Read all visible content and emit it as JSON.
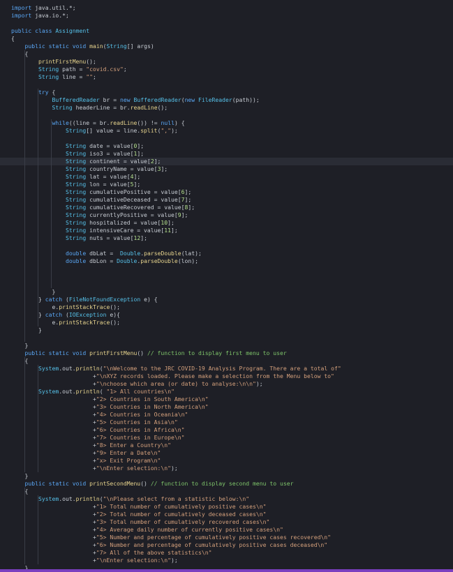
{
  "editor": {
    "lines": [
      [
        [
          "kw",
          "import"
        ],
        [
          "txt",
          " java.util.*;"
        ]
      ],
      [
        [
          "kw",
          "import"
        ],
        [
          "txt",
          " java.io.*;"
        ]
      ],
      [],
      [
        [
          "kw",
          "public class"
        ],
        [
          "ty",
          " Assignment"
        ]
      ],
      [
        [
          "txt",
          "{"
        ]
      ],
      [
        [
          "txt",
          "    "
        ],
        [
          "kw",
          "public static void"
        ],
        [
          "fn",
          " main"
        ],
        [
          "txt",
          "("
        ],
        [
          "ty",
          "String"
        ],
        [
          "txt",
          "[] args)"
        ]
      ],
      [
        [
          "txt",
          "    {"
        ]
      ],
      [
        [
          "txt",
          "        "
        ],
        [
          "fn",
          "printFirstMenu"
        ],
        [
          "txt",
          "();"
        ]
      ],
      [
        [
          "txt",
          "        "
        ],
        [
          "ty",
          "String"
        ],
        [
          "txt",
          " path = "
        ],
        [
          "str",
          "\"covid.csv\""
        ],
        [
          "txt",
          ";"
        ]
      ],
      [
        [
          "txt",
          "        "
        ],
        [
          "ty",
          "String"
        ],
        [
          "txt",
          " line = "
        ],
        [
          "str",
          "\"\""
        ],
        [
          "txt",
          ";"
        ]
      ],
      [],
      [
        [
          "txt",
          "        "
        ],
        [
          "kw",
          "try"
        ],
        [
          "txt",
          " {"
        ]
      ],
      [
        [
          "txt",
          "            "
        ],
        [
          "ty",
          "BufferedReader"
        ],
        [
          "txt",
          " br = "
        ],
        [
          "kw",
          "new"
        ],
        [
          "ty",
          " BufferedReader"
        ],
        [
          "txt",
          "("
        ],
        [
          "kw",
          "new"
        ],
        [
          "ty",
          " FileReader"
        ],
        [
          "txt",
          "(path));"
        ]
      ],
      [
        [
          "txt",
          "            "
        ],
        [
          "ty",
          "String"
        ],
        [
          "txt",
          " headerLine = br."
        ],
        [
          "fn",
          "readLine"
        ],
        [
          "txt",
          "();"
        ]
      ],
      [],
      [
        [
          "txt",
          "            "
        ],
        [
          "kw",
          "while"
        ],
        [
          "txt",
          "((line = br."
        ],
        [
          "fn",
          "readLine"
        ],
        [
          "txt",
          "()) != "
        ],
        [
          "kw",
          "null"
        ],
        [
          "txt",
          ") {"
        ]
      ],
      [
        [
          "txt",
          "                "
        ],
        [
          "ty",
          "String"
        ],
        [
          "txt",
          "[] value = line."
        ],
        [
          "fn",
          "split"
        ],
        [
          "txt",
          "("
        ],
        [
          "str",
          "\",\""
        ],
        [
          "txt",
          ");"
        ]
      ],
      [],
      [
        [
          "txt",
          "                "
        ],
        [
          "ty",
          "String"
        ],
        [
          "txt",
          " date = value["
        ],
        [
          "num",
          "0"
        ],
        [
          "txt",
          "];"
        ]
      ],
      [
        [
          "txt",
          "                "
        ],
        [
          "ty",
          "String"
        ],
        [
          "txt",
          " iso3 = value["
        ],
        [
          "num",
          "1"
        ],
        [
          "txt",
          "];"
        ]
      ],
      [
        [
          "txt",
          "                "
        ],
        [
          "ty",
          "String"
        ],
        [
          "txt",
          " continent = value["
        ],
        [
          "num",
          "2"
        ],
        [
          "txt",
          "];"
        ]
      ],
      [
        [
          "txt",
          "                "
        ],
        [
          "ty",
          "String"
        ],
        [
          "txt",
          " countryName = value["
        ],
        [
          "num",
          "3"
        ],
        [
          "txt",
          "];"
        ]
      ],
      [
        [
          "txt",
          "                "
        ],
        [
          "ty",
          "String"
        ],
        [
          "txt",
          " lat = value["
        ],
        [
          "num",
          "4"
        ],
        [
          "txt",
          "];"
        ]
      ],
      [
        [
          "txt",
          "                "
        ],
        [
          "ty",
          "String"
        ],
        [
          "txt",
          " lon = value["
        ],
        [
          "num",
          "5"
        ],
        [
          "txt",
          "];"
        ]
      ],
      [
        [
          "txt",
          "                "
        ],
        [
          "ty",
          "String"
        ],
        [
          "txt",
          " cumulativePositive = value["
        ],
        [
          "num",
          "6"
        ],
        [
          "txt",
          "];"
        ]
      ],
      [
        [
          "txt",
          "                "
        ],
        [
          "ty",
          "String"
        ],
        [
          "txt",
          " cumulativeDeceased = value["
        ],
        [
          "num",
          "7"
        ],
        [
          "txt",
          "];"
        ]
      ],
      [
        [
          "txt",
          "                "
        ],
        [
          "ty",
          "String"
        ],
        [
          "txt",
          " cumulativeRecovered = value["
        ],
        [
          "num",
          "8"
        ],
        [
          "txt",
          "];"
        ]
      ],
      [
        [
          "txt",
          "                "
        ],
        [
          "ty",
          "String"
        ],
        [
          "txt",
          " currentlyPositive = value["
        ],
        [
          "num",
          "9"
        ],
        [
          "txt",
          "];"
        ]
      ],
      [
        [
          "txt",
          "                "
        ],
        [
          "ty",
          "String"
        ],
        [
          "txt",
          " hospitalized = value["
        ],
        [
          "num",
          "10"
        ],
        [
          "txt",
          "];"
        ]
      ],
      [
        [
          "txt",
          "                "
        ],
        [
          "ty",
          "String"
        ],
        [
          "txt",
          " intensiveCare = value["
        ],
        [
          "num",
          "11"
        ],
        [
          "txt",
          "];"
        ]
      ],
      [
        [
          "txt",
          "                "
        ],
        [
          "ty",
          "String"
        ],
        [
          "txt",
          " nuts = value["
        ],
        [
          "num",
          "12"
        ],
        [
          "txt",
          "];"
        ]
      ],
      [],
      [
        [
          "txt",
          "                "
        ],
        [
          "kw",
          "double"
        ],
        [
          "txt",
          " dbLat =  "
        ],
        [
          "ty",
          "Double"
        ],
        [
          "txt",
          "."
        ],
        [
          "fn",
          "parseDouble"
        ],
        [
          "txt",
          "(lat);"
        ]
      ],
      [
        [
          "txt",
          "                "
        ],
        [
          "kw",
          "double"
        ],
        [
          "txt",
          " dbLon = "
        ],
        [
          "ty",
          "Double"
        ],
        [
          "txt",
          "."
        ],
        [
          "fn",
          "parseDouble"
        ],
        [
          "txt",
          "(lon);"
        ]
      ],
      [],
      [],
      [],
      [
        [
          "txt",
          "            }"
        ]
      ],
      [
        [
          "txt",
          "        } "
        ],
        [
          "kw",
          "catch"
        ],
        [
          "txt",
          " ("
        ],
        [
          "ty",
          "FileNotFoundException"
        ],
        [
          "txt",
          " e) {"
        ]
      ],
      [
        [
          "txt",
          "            e."
        ],
        [
          "fn",
          "printStackTrace"
        ],
        [
          "txt",
          "();"
        ]
      ],
      [
        [
          "txt",
          "        } "
        ],
        [
          "kw",
          "catch"
        ],
        [
          "txt",
          " ("
        ],
        [
          "ty",
          "IOException"
        ],
        [
          "txt",
          " e){"
        ]
      ],
      [
        [
          "txt",
          "            e."
        ],
        [
          "fn",
          "printStackTrace"
        ],
        [
          "txt",
          "();"
        ]
      ],
      [
        [
          "txt",
          "        }"
        ]
      ],
      [],
      [
        [
          "txt",
          "    }"
        ]
      ],
      [
        [
          "txt",
          "    "
        ],
        [
          "kw",
          "public static void"
        ],
        [
          "fn",
          " printFirstMenu"
        ],
        [
          "txt",
          "() "
        ],
        [
          "cm",
          "// function to display first menu to user"
        ]
      ],
      [
        [
          "txt",
          "    {"
        ]
      ],
      [
        [
          "txt",
          "        "
        ],
        [
          "ty",
          "System"
        ],
        [
          "txt",
          ".out."
        ],
        [
          "fn",
          "println"
        ],
        [
          "txt",
          "("
        ],
        [
          "str",
          "\"\\nWelcome to the JRC COVID-19 Analysis Program. There are a total of\""
        ]
      ],
      [
        [
          "txt",
          "                        +"
        ],
        [
          "str",
          "\"\\nXYZ records loaded. Please make a selection from the Menu below to\""
        ]
      ],
      [
        [
          "txt",
          "                        +"
        ],
        [
          "str",
          "\"\\nchoose which area (or date) to analyse:\\n\\n\""
        ],
        [
          "txt",
          ");"
        ]
      ],
      [
        [
          "txt",
          "        "
        ],
        [
          "ty",
          "System"
        ],
        [
          "txt",
          ".out."
        ],
        [
          "fn",
          "println"
        ],
        [
          "txt",
          "( "
        ],
        [
          "str",
          "\"1> All countries\\n\""
        ]
      ],
      [
        [
          "txt",
          "                        +"
        ],
        [
          "str",
          "\"2> Countries in South America\\n\""
        ]
      ],
      [
        [
          "txt",
          "                        +"
        ],
        [
          "str",
          "\"3> Countries in North America\\n\""
        ]
      ],
      [
        [
          "txt",
          "                        +"
        ],
        [
          "str",
          "\"4> Countries in Oceania\\n\""
        ]
      ],
      [
        [
          "txt",
          "                        +"
        ],
        [
          "str",
          "\"5> Countries in Asia\\n\""
        ]
      ],
      [
        [
          "txt",
          "                        +"
        ],
        [
          "str",
          "\"6> Countries in Africa\\n\""
        ]
      ],
      [
        [
          "txt",
          "                        +"
        ],
        [
          "str",
          "\"7> Countries in Europe\\n\""
        ]
      ],
      [
        [
          "txt",
          "                        +"
        ],
        [
          "str",
          "\"8> Enter a Country\\n\""
        ]
      ],
      [
        [
          "txt",
          "                        +"
        ],
        [
          "str",
          "\"9> Enter a Date\\n\""
        ]
      ],
      [
        [
          "txt",
          "                        +"
        ],
        [
          "str",
          "\"x> Exit Program\\n\""
        ]
      ],
      [
        [
          "txt",
          "                        +"
        ],
        [
          "str",
          "\"\\nEnter selection:\\n\""
        ],
        [
          "txt",
          ");"
        ]
      ],
      [
        [
          "txt",
          "    }"
        ]
      ],
      [
        [
          "txt",
          "    "
        ],
        [
          "kw",
          "public static void"
        ],
        [
          "fn",
          " printSecondMenu"
        ],
        [
          "txt",
          "() "
        ],
        [
          "cm",
          "// function to display second menu to user"
        ]
      ],
      [
        [
          "txt",
          "    {"
        ]
      ],
      [
        [
          "txt",
          "        "
        ],
        [
          "ty",
          "System"
        ],
        [
          "txt",
          ".out."
        ],
        [
          "fn",
          "println"
        ],
        [
          "txt",
          "("
        ],
        [
          "str",
          "\"\\nPlease select from a statistic below:\\n\""
        ]
      ],
      [
        [
          "txt",
          "                        +"
        ],
        [
          "str",
          "\"1> Total number of cumulatively positive cases\\n\""
        ]
      ],
      [
        [
          "txt",
          "                        +"
        ],
        [
          "str",
          "\"2> Total number of cumulatively deceased cases\\n\""
        ]
      ],
      [
        [
          "txt",
          "                        +"
        ],
        [
          "str",
          "\"3> Total number of cumulatively recovered cases\\n\""
        ]
      ],
      [
        [
          "txt",
          "                        +"
        ],
        [
          "str",
          "\"4> Average daily number of currently positive cases\\n\""
        ]
      ],
      [
        [
          "txt",
          "                        +"
        ],
        [
          "str",
          "\"5> Number and percentage of cumulatively positive cases recovered\\n\""
        ]
      ],
      [
        [
          "txt",
          "                        +"
        ],
        [
          "str",
          "\"6> Number and percentage of cumulatively positive cases deceased\\n\""
        ]
      ],
      [
        [
          "txt",
          "                        +"
        ],
        [
          "str",
          "\"7> All of the above statistics\\n\""
        ]
      ],
      [
        [
          "txt",
          "                        +"
        ],
        [
          "str",
          "\"\\nEnter selection:\\n\""
        ],
        [
          "txt",
          ");"
        ]
      ],
      [
        [
          "txt",
          "    }"
        ]
      ]
    ],
    "highlight_line": 20,
    "colors": {
      "background": "#1e1f26",
      "keyword": "#5aa7f5",
      "type": "#56c0e8",
      "function": "#e8d58e",
      "string": "#d4a07c",
      "comment": "#7ec46a",
      "number": "#b5e08e",
      "text": "#c8cdd4",
      "status_bar": "#7a3fbf"
    }
  }
}
